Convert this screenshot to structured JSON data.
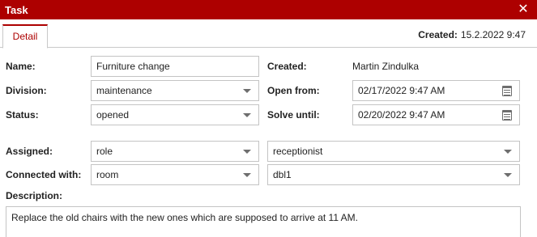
{
  "window": {
    "title": "Task",
    "close_glyph": "✕"
  },
  "tabs": [
    {
      "label": "Detail",
      "active": true
    }
  ],
  "header": {
    "created_label": "Created:",
    "created_value": "15.2.2022 9:47"
  },
  "form": {
    "name": {
      "label": "Name:",
      "value": "Furniture change"
    },
    "created": {
      "label": "Created:",
      "value": "Martin Zindulka"
    },
    "division": {
      "label": "Division:",
      "value": "maintenance"
    },
    "open_from": {
      "label": "Open from:",
      "value": "02/17/2022 9:47 AM"
    },
    "status": {
      "label": "Status:",
      "value": "opened"
    },
    "solve_until": {
      "label": "Solve until:",
      "value": "02/20/2022 9:47 AM"
    },
    "assigned": {
      "label": "Assigned:",
      "type_value": "role",
      "target_value": "receptionist"
    },
    "connected_with": {
      "label": "Connected with:",
      "type_value": "room",
      "target_value": "dbl1"
    },
    "description": {
      "label": "Description:",
      "value": "Replace the old chairs with the new ones which are supposed to arrive at 11 AM."
    }
  },
  "icons": {
    "close": "close-icon",
    "dropdown": "chevron-down-icon",
    "calendar": "calendar-icon"
  },
  "colors": {
    "accent": "#ad0000",
    "border": "#c4c4c4"
  }
}
